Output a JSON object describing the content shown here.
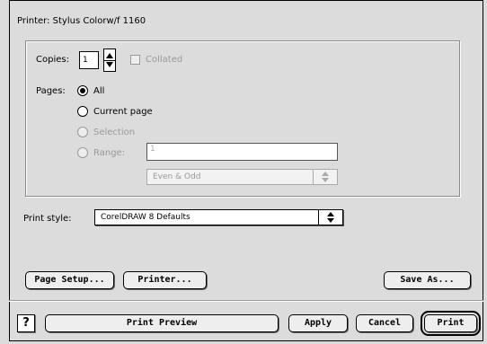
{
  "printer": {
    "label": "Printer: Stylus Colorw/f 1160"
  },
  "copies": {
    "label": "Copies:",
    "value": "1",
    "collated_label": "Collated",
    "collated_checked": false
  },
  "pages": {
    "label": "Pages:",
    "options": [
      {
        "label": "All",
        "selected": true,
        "enabled": true
      },
      {
        "label": "Current page",
        "selected": false,
        "enabled": true
      },
      {
        "label": "Selection",
        "selected": false,
        "enabled": false
      },
      {
        "label": "Range:",
        "selected": false,
        "enabled": false
      }
    ],
    "range_value": "1",
    "even_odd": "Even & Odd"
  },
  "print_style": {
    "label": "Print style:",
    "value": "CorelDRAW 8 Defaults"
  },
  "buttons": {
    "page_setup": "Page Setup...",
    "printer": "Printer...",
    "save_as": "Save As...",
    "help": "?",
    "print_preview": "Print Preview",
    "apply": "Apply",
    "cancel": "Cancel",
    "print": "Print"
  },
  "colors": {
    "background": "#dcdcdc",
    "disabled_text": "#999999",
    "help_accent": "#f7e27a"
  }
}
